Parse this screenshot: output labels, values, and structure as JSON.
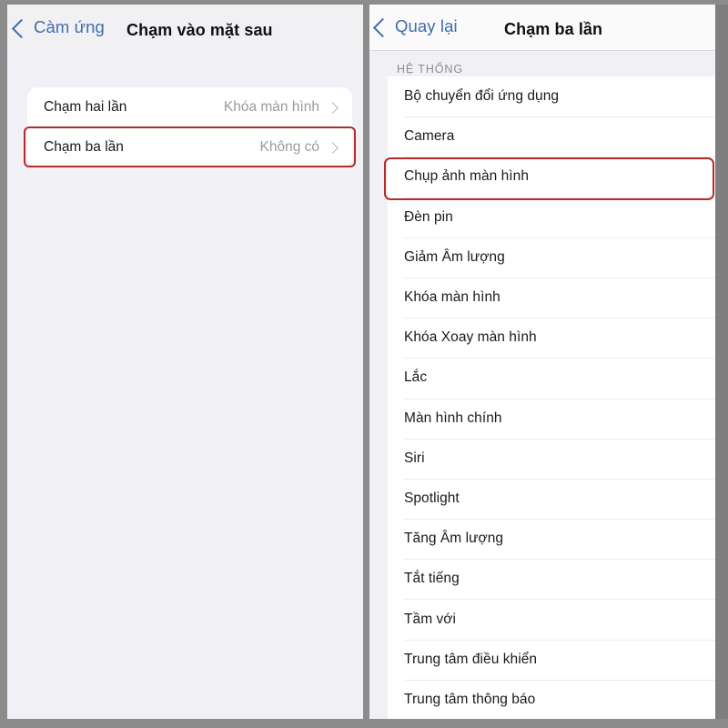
{
  "left_panel": {
    "nav": {
      "back_label": "Càm ứng",
      "back_icon": "chevron-left-icon",
      "title": "Chạm vào mặt sau"
    },
    "rows": [
      {
        "label": "Chạm hai lần",
        "value": "Khóa màn hình",
        "chevron": "chevron-right-icon"
      },
      {
        "label": "Chạm ba lần",
        "value": "Không có",
        "chevron": "chevron-right-icon"
      }
    ],
    "highlight": {
      "row_index": 1,
      "color": "#b52a2a"
    }
  },
  "right_panel": {
    "nav": {
      "back_label": "Quay lại",
      "back_icon": "chevron-left-icon",
      "title": "Chạm ba lần"
    },
    "section_header": "HỆ THỐNG",
    "rows": [
      {
        "label": "Bộ chuyển đổi ứng dụng"
      },
      {
        "label": "Camera"
      },
      {
        "label": "Chụp ảnh màn hình"
      },
      {
        "label": "Đèn pin"
      },
      {
        "label": "Giảm Âm lượng"
      },
      {
        "label": "Khóa màn hình"
      },
      {
        "label": "Khóa Xoay màn hình"
      },
      {
        "label": "Lắc"
      },
      {
        "label": "Màn hình chính"
      },
      {
        "label": "Siri"
      },
      {
        "label": "Spotlight"
      },
      {
        "label": "Tăng Âm lượng"
      },
      {
        "label": "Tắt tiếng"
      },
      {
        "label": "Tầm với"
      },
      {
        "label": "Trung tâm điều khiển"
      },
      {
        "label": "Trung tâm thông báo"
      }
    ],
    "highlight": {
      "row_index": 2,
      "color": "#b52a2a"
    }
  },
  "colors": {
    "accent_blue": "#3f6bae",
    "highlight_red": "#b52a2a",
    "page_background": "#f1f1f5",
    "card_background": "#ffffff",
    "secondary_text": "#9a9aa1",
    "frame_gray": "#8c8c8c"
  }
}
